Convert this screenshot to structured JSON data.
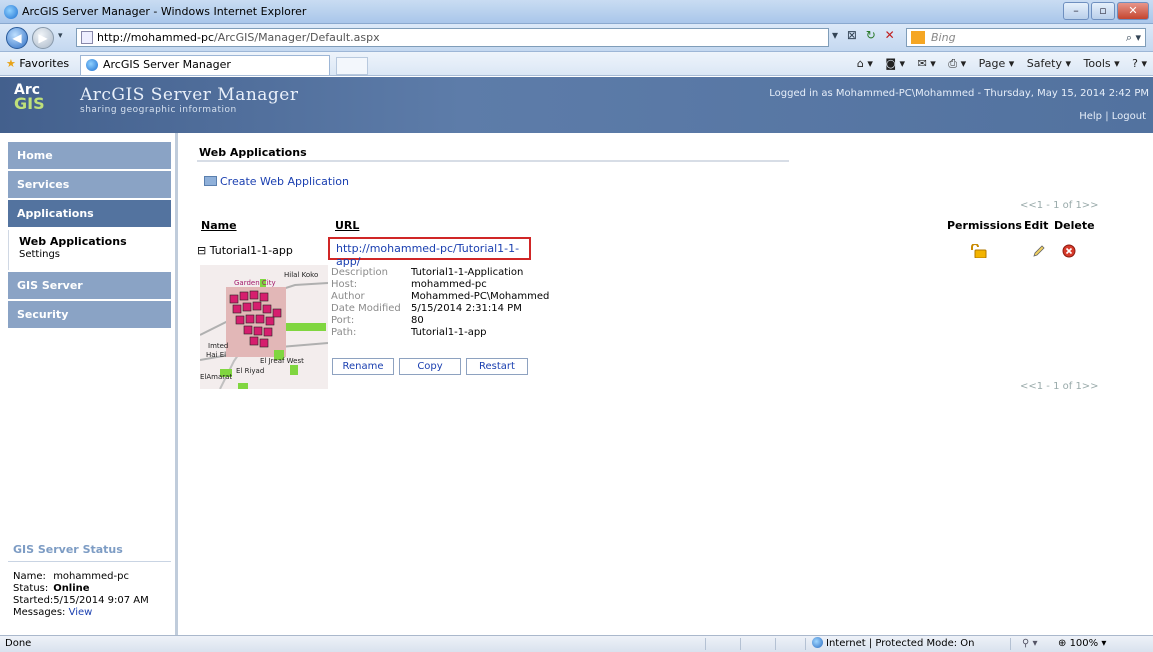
{
  "browser": {
    "window_title": "ArcGIS Server Manager - Windows Internet Explorer",
    "address_host": "http://mohammed-pc",
    "address_path": "/ArcGIS/Manager/Default.aspx",
    "search_placeholder": "Bing",
    "favorites_label": "Favorites",
    "tab_title": "ArcGIS Server Manager",
    "command_page": "Page ▾",
    "command_safety": "Safety ▾",
    "command_tools": "Tools ▾",
    "status_done": "Done",
    "status_zone": "Internet | Protected Mode: On",
    "zoom": "100%"
  },
  "header": {
    "logo_arc": "Arc",
    "logo_gis": "GIS",
    "brand": "ArcGIS Server Manager",
    "tagline": "sharing geographic information",
    "login_text": "Logged in as Mohammed-PC\\Mohammed - Thursday, May 15, 2014 2:42 PM",
    "help": "Help",
    "logout": "Logout"
  },
  "sidebar": {
    "items": [
      {
        "label": "Home"
      },
      {
        "label": "Services"
      },
      {
        "label": "Applications"
      },
      {
        "label": "GIS Server"
      },
      {
        "label": "Security"
      }
    ],
    "sub_items": [
      {
        "label": "Web Applications"
      },
      {
        "label": "Settings"
      }
    ],
    "status": {
      "heading": "GIS Server Status",
      "name_label": "Name:",
      "name_value": "mohammed-pc",
      "status_label": "Status:",
      "status_value": "Online",
      "started_label": "Started:",
      "started_value": "5/15/2014 9:07 AM",
      "messages_label": "Messages:",
      "messages_link": "View"
    }
  },
  "main": {
    "heading": "Web Applications",
    "create_link": "Create Web Application",
    "pager_top": "<<1 - 1 of 1>>",
    "pager_bottom": "<<1 - 1 of 1>>",
    "columns": {
      "name": "Name",
      "url": "URL",
      "permissions": "Permissions",
      "edit": "Edit",
      "delete": "Delete"
    },
    "app": {
      "expander": "⊟",
      "name": "Tutorial1-1-app",
      "url": "http://mohammed-pc/Tutorial1-1-app/",
      "details": [
        {
          "key": "Description",
          "value": "Tutorial1-1-Application"
        },
        {
          "key": "Host:",
          "value": "mohammed-pc"
        },
        {
          "key": "Author",
          "value": "Mohammed-PC\\Mohammed"
        },
        {
          "key": "Date Modified",
          "value": "5/15/2014 2:31:14 PM"
        },
        {
          "key": "Port:",
          "value": "80"
        },
        {
          "key": "Path:",
          "value": "Tutorial1-1-app"
        }
      ],
      "buttons": {
        "rename": "Rename",
        "copy": "Copy",
        "restart": "Restart"
      },
      "map_labels": [
        "Garden City",
        "Hilal Koko",
        "Imted",
        "Hai El",
        "El Jreaf West",
        "El Riyad",
        "ElAmarat"
      ]
    }
  },
  "colors": {
    "banner": "#52729f",
    "nav_inactive": "#8aa3c5",
    "nav_active": "#53739f",
    "link": "#1a3fb0",
    "url_highlight": "#d02626"
  }
}
